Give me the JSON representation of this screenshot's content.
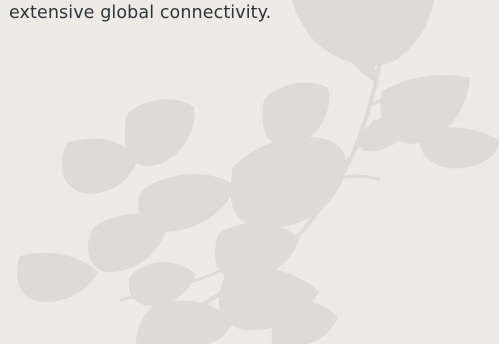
{
  "content": {
    "text_line": "extensive global connectivity."
  },
  "colors": {
    "background": "#eeebe6",
    "text": "#2f3338",
    "foliage": "#dedad4"
  },
  "decoration": {
    "foliage_icon": "leafy-branch-illustration"
  }
}
